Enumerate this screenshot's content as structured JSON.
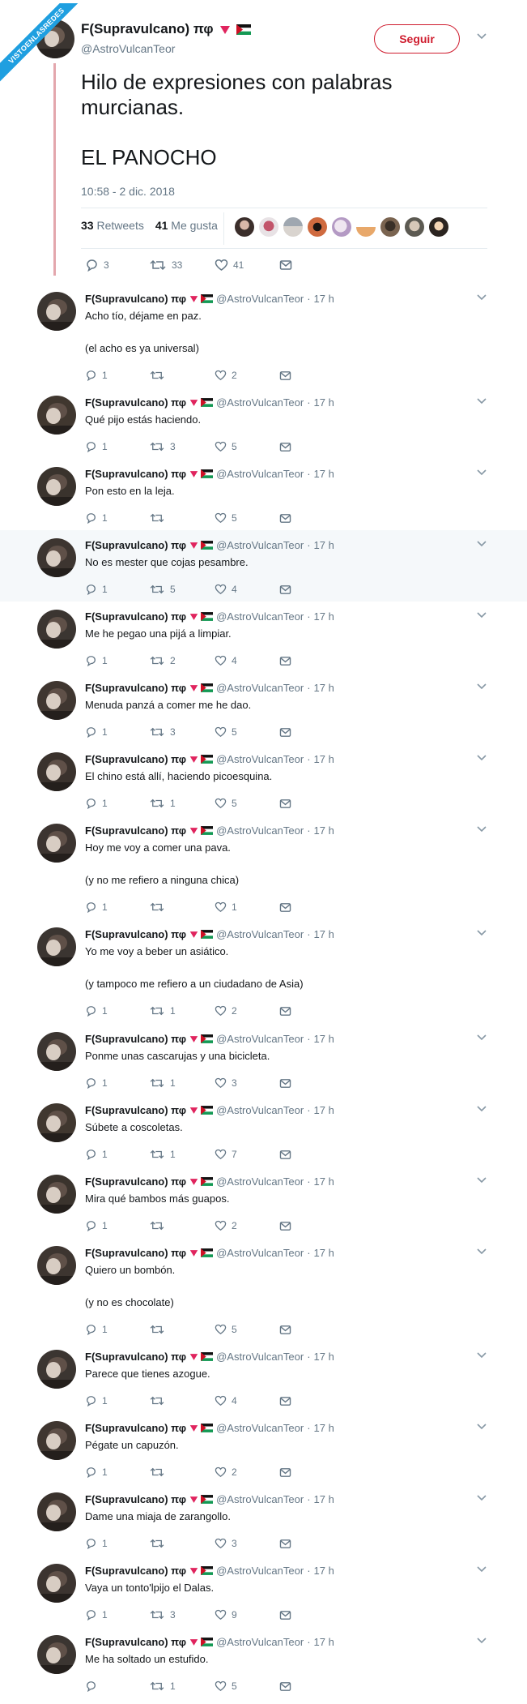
{
  "watermark": "VISTOENLASREDES",
  "author": {
    "name": "F(Supravulcano) πφ",
    "handle": "@AstroVulcanTeor"
  },
  "follow_label": "Seguir",
  "main_tweet": {
    "text": "Hilo de expresiones con palabras murcianas.\n\nEL PANOCHO",
    "timestamp": "10:58 - 2 dic. 2018",
    "retweets_count": "33",
    "retweets_label": "Retweets",
    "likes_count": "41",
    "likes_label": "Me gusta",
    "reply_count": "3",
    "retweet_count": "33",
    "like_count": "41"
  },
  "reply_time": "17 h",
  "colors": {
    "follow_red": "#cf1c2e",
    "thread_line": "#e3a7ad",
    "muted": "#657786",
    "highlight_bg": "#f5f8fa"
  },
  "replies": [
    {
      "text": "Acho tío, déjame en paz.\n\n(el acho es ya universal)",
      "replies": "1",
      "retweets": "",
      "likes": "2"
    },
    {
      "text": "Qué pijo estás haciendo.",
      "replies": "1",
      "retweets": "3",
      "likes": "5"
    },
    {
      "text": "Pon esto en la leja.",
      "replies": "1",
      "retweets": "",
      "likes": "5"
    },
    {
      "text": "No es mester que cojas pesambre.",
      "replies": "1",
      "retweets": "5",
      "likes": "4"
    },
    {
      "text": "Me he pegao una pijá a limpiar.",
      "replies": "1",
      "retweets": "2",
      "likes": "4"
    },
    {
      "text": "Menuda panzá a comer me he dao.",
      "replies": "1",
      "retweets": "3",
      "likes": "5"
    },
    {
      "text": "El chino está allí, haciendo picoesquina.",
      "replies": "1",
      "retweets": "1",
      "likes": "5"
    },
    {
      "text": "Hoy me voy a comer una pava.\n\n(y no me refiero a ninguna chica)",
      "replies": "1",
      "retweets": "",
      "likes": "1"
    },
    {
      "text": "Yo me voy a beber un asiático.\n\n(y tampoco me refiero a un ciudadano de Asia)",
      "replies": "1",
      "retweets": "1",
      "likes": "2"
    },
    {
      "text": "Ponme unas cascarujas y una bicicleta.",
      "replies": "1",
      "retweets": "1",
      "likes": "3"
    },
    {
      "text": "Súbete a coscoletas.",
      "replies": "1",
      "retweets": "1",
      "likes": "7"
    },
    {
      "text": "Mira qué bambos más guapos.",
      "replies": "1",
      "retweets": "",
      "likes": "2"
    },
    {
      "text": "Quiero un bombón.\n\n(y no es chocolate)",
      "replies": "1",
      "retweets": "",
      "likes": "5"
    },
    {
      "text": "Parece que tienes azogue.",
      "replies": "1",
      "retweets": "",
      "likes": "4"
    },
    {
      "text": "Pégate un capuzón.",
      "replies": "1",
      "retweets": "",
      "likes": "2"
    },
    {
      "text": "Dame una miaja de zarangollo.",
      "replies": "1",
      "retweets": "",
      "likes": "3"
    },
    {
      "text": "Vaya un tonto'lpijo el Dalas.",
      "replies": "1",
      "retweets": "3",
      "likes": "9"
    },
    {
      "text": "Me ha soltado un estufido.",
      "replies": "",
      "retweets": "1",
      "likes": "5"
    }
  ]
}
